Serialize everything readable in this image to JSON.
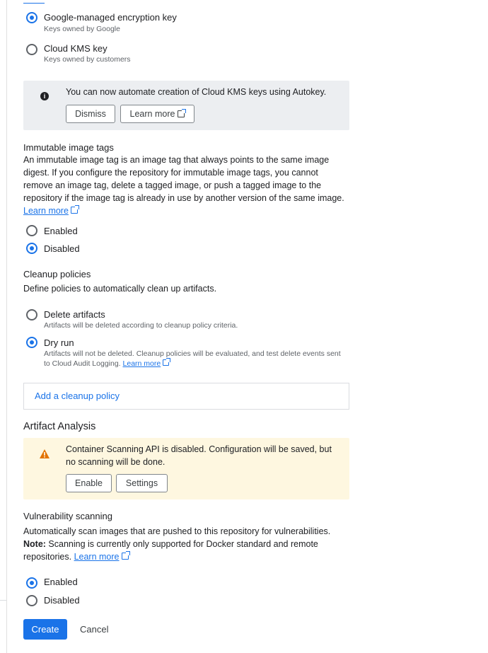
{
  "encryption": {
    "google_managed": {
      "label": "Google-managed encryption key",
      "sub": "Keys owned by Google",
      "selected": true
    },
    "cloud_kms": {
      "label": "Cloud KMS key",
      "sub": "Keys owned by customers",
      "selected": false
    },
    "autokey_banner": {
      "text": "You can now automate creation of Cloud KMS keys using Autokey.",
      "dismiss": "Dismiss",
      "learn_more": "Learn more"
    }
  },
  "immutable_tags": {
    "title": "Immutable image tags",
    "description": "An immutable image tag is an image tag that always points to the same image digest. If you configure the repository for immutable image tags, you cannot remove an image tag, delete a tagged image, or push a tagged image to the repository if the image tag is already in use by another version of the same image.",
    "learn_more": "Learn more",
    "enabled": "Enabled",
    "disabled": "Disabled",
    "selected": "Disabled"
  },
  "cleanup": {
    "title": "Cleanup policies",
    "description": "Define policies to automatically clean up artifacts.",
    "delete_label": "Delete artifacts",
    "delete_sub": "Artifacts will be deleted according to cleanup policy criteria.",
    "dryrun_label": "Dry run",
    "dryrun_sub1": "Artifacts will not be deleted. Cleanup policies will be evaluated, and test delete events sent",
    "dryrun_sub2": "to Cloud Audit Logging.",
    "learn_more": "Learn more",
    "add_policy": "Add a cleanup policy",
    "selected": "Dry run"
  },
  "artifact_analysis": {
    "title": "Artifact Analysis",
    "warning_text": "Container Scanning API is disabled. Configuration will be saved, but no scanning will be done.",
    "enable": "Enable",
    "settings": "Settings"
  },
  "vuln_scanning": {
    "title": "Vulnerability scanning",
    "description": "Automatically scan images that are pushed to this repository for vulnerabilities.",
    "note_label": "Note:",
    "note_text": " Scanning is currently only supported for Docker standard and remote repositories.",
    "learn_more": "Learn more",
    "enabled": "Enabled",
    "disabled": "Disabled",
    "selected": "Enabled"
  },
  "actions": {
    "create": "Create",
    "cancel": "Cancel"
  },
  "colors": {
    "accent": "#1a73e8",
    "warning": "#e37400",
    "info_bg": "#eceef1",
    "warning_bg": "#fef7e0"
  }
}
